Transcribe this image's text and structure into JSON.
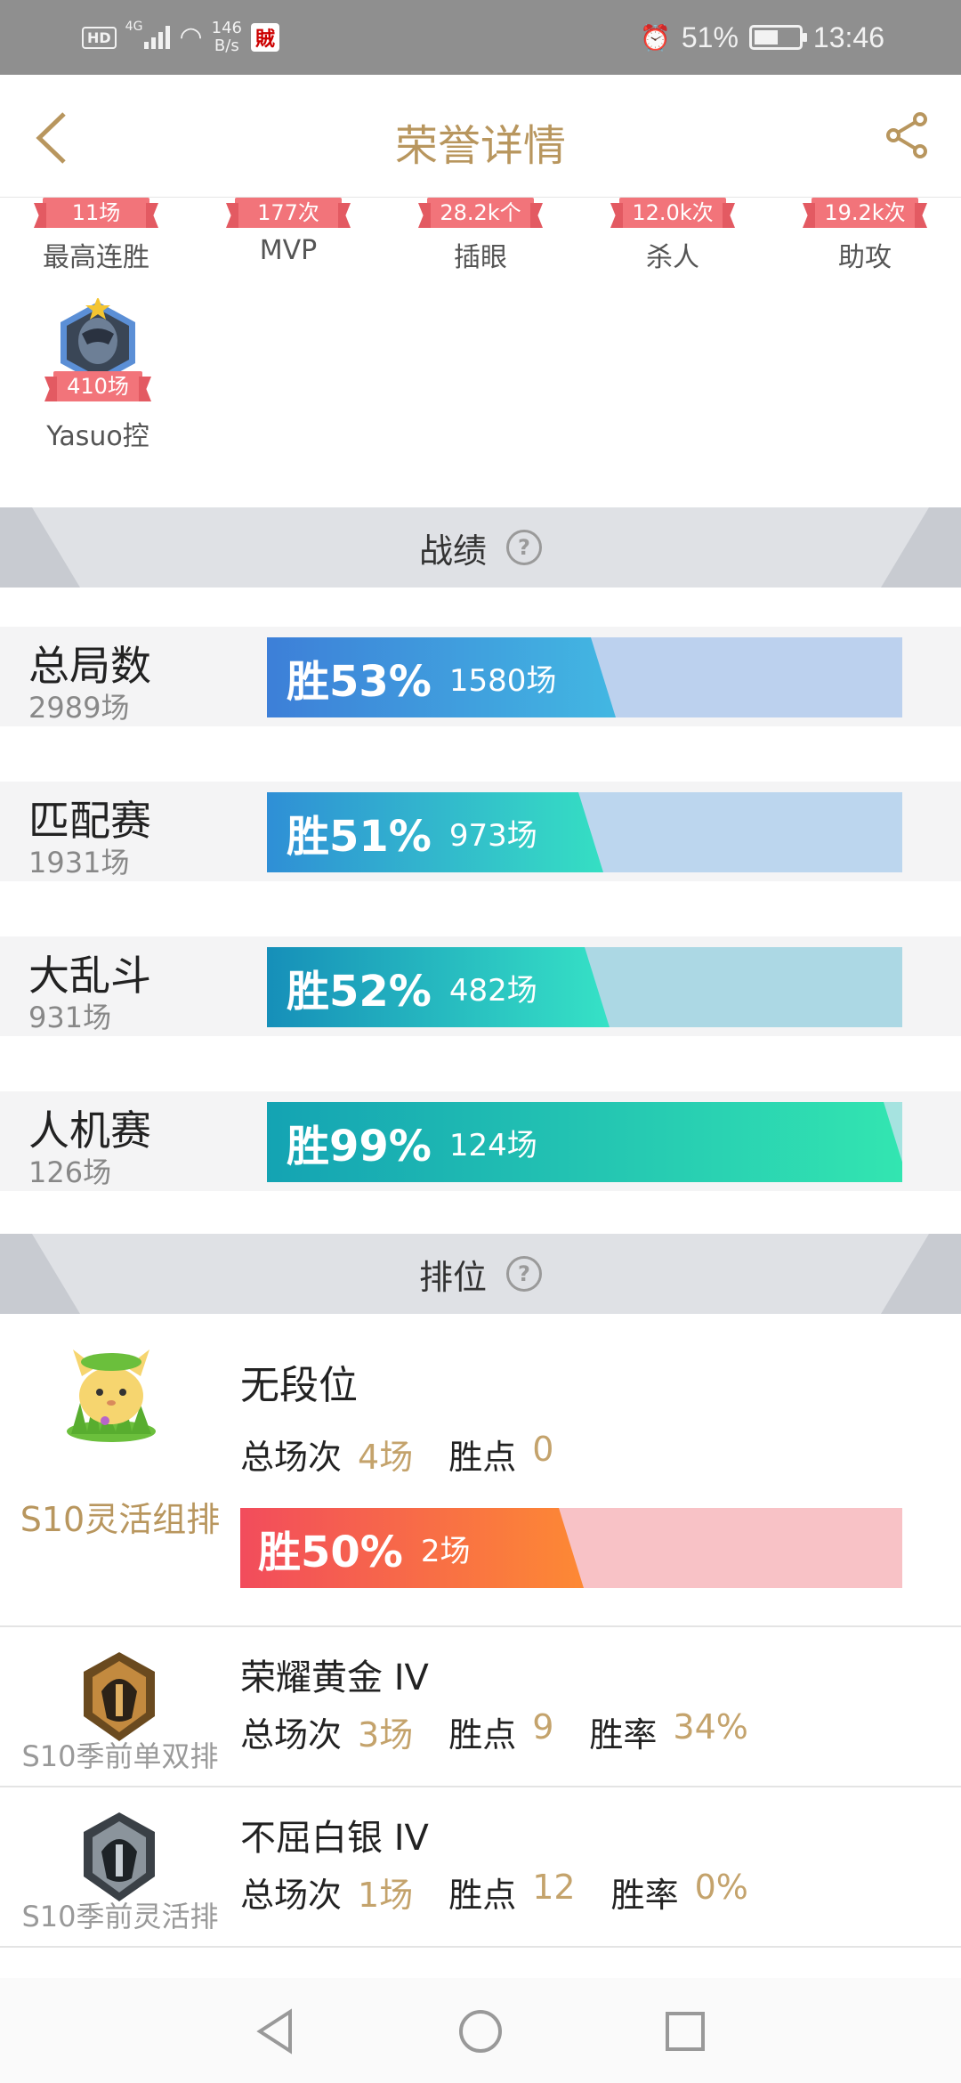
{
  "status_bar": {
    "hd": "HD",
    "network": "4G",
    "speed_value": "146",
    "speed_unit": "B/s",
    "app_icon_text": "賊",
    "battery": "51%",
    "time": "13:46"
  },
  "header": {
    "title": "荣誉详情"
  },
  "achievements": [
    {
      "value": "11场",
      "label": "最高连胜"
    },
    {
      "value": "177次",
      "label": "MVP"
    },
    {
      "value": "28.2k个",
      "label": "插眼"
    },
    {
      "value": "12.0k次",
      "label": "杀人"
    },
    {
      "value": "19.2k次",
      "label": "助攻"
    }
  ],
  "champion_badge": {
    "value": "410场",
    "label": "Yasuo控"
  },
  "record_section": {
    "title": "战绩",
    "help": "?"
  },
  "stats": [
    {
      "name": "总局数",
      "count": "2989场",
      "pct_label": "胜53%",
      "wins": "1580场",
      "win_rate": 0.53
    },
    {
      "name": "匹配赛",
      "count": "1931场",
      "pct_label": "胜51%",
      "wins": "973场",
      "win_rate": 0.51
    },
    {
      "name": "大乱斗",
      "count": "931场",
      "pct_label": "胜52%",
      "wins": "482场",
      "win_rate": 0.52
    },
    {
      "name": "人机赛",
      "count": "126场",
      "pct_label": "胜99%",
      "wins": "124场",
      "win_rate": 0.99
    }
  ],
  "rank_section": {
    "title": "排位",
    "help": "?"
  },
  "ranked": {
    "queue": "S10灵活组排",
    "tier": "无段位",
    "total_label": "总场次",
    "total_value": "4场",
    "points_label": "胜点",
    "points_value": "0",
    "pct_label": "胜50%",
    "wins": "2场",
    "win_rate": 0.5
  },
  "ranked_rows": [
    {
      "queue": "S10季前单双排",
      "tier": "荣耀黄金 IV",
      "total_label": "总场次",
      "total_value": "3场",
      "points_label": "胜点",
      "points_value": "9",
      "rate_label": "胜率",
      "rate_value": "34%"
    },
    {
      "queue": "S10季前灵活排",
      "tier": "不屈白银 IV",
      "total_label": "总场次",
      "total_value": "1场",
      "points_label": "胜点",
      "points_value": "12",
      "rate_label": "胜率",
      "rate_value": "0%"
    }
  ],
  "colors": {
    "accent_gold": "#b8965e",
    "ribbon_red": "#f2747a"
  }
}
